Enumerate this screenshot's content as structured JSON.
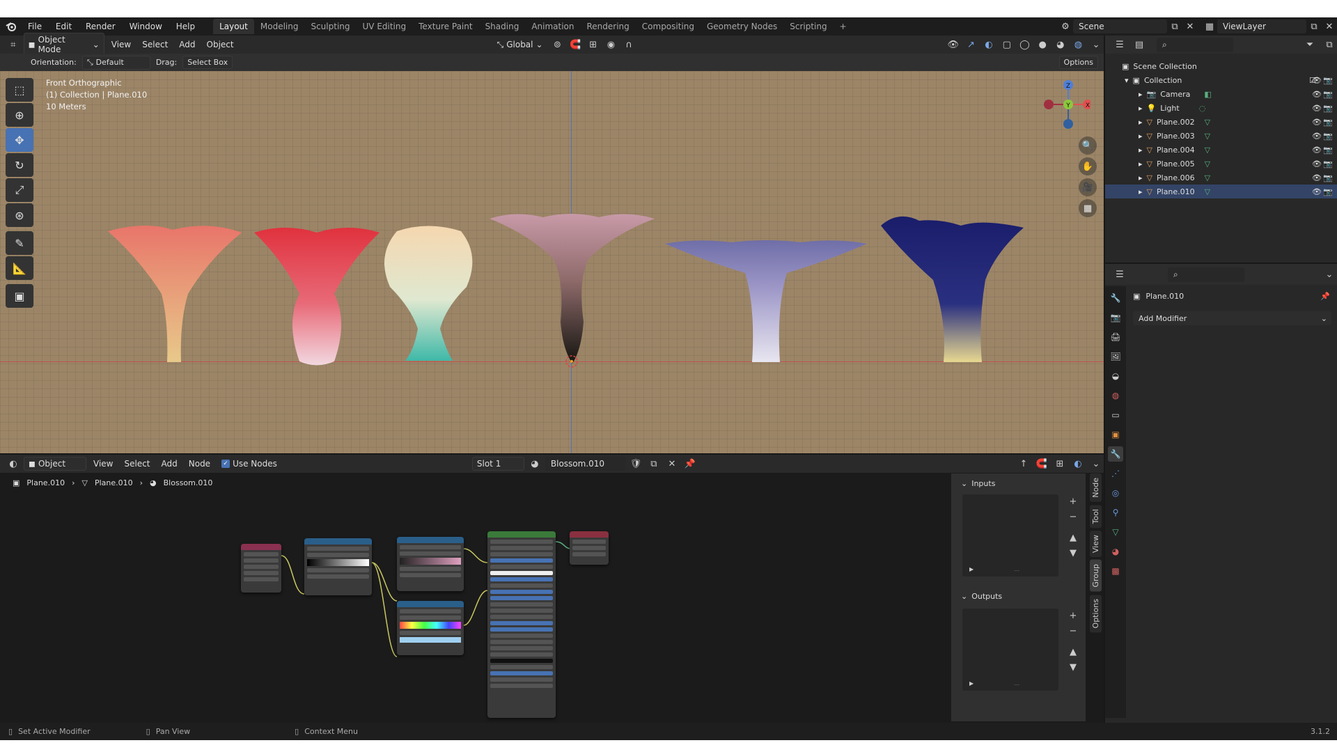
{
  "menu": [
    "File",
    "Edit",
    "Render",
    "Window",
    "Help"
  ],
  "workspaces": [
    "Layout",
    "Modeling",
    "Sculpting",
    "UV Editing",
    "Texture Paint",
    "Shading",
    "Animation",
    "Rendering",
    "Compositing",
    "Geometry Nodes",
    "Scripting"
  ],
  "plus": "+",
  "scene": "Scene",
  "view_layer": "ViewLayer",
  "view3d_header": {
    "mode": "Object Mode",
    "view": "View",
    "select": "Select",
    "add": "Add",
    "object": "Object",
    "transform": "Global"
  },
  "tool_header": {
    "orientation_label": "Orientation:",
    "orientation": "Default",
    "drag_label": "Drag:",
    "drag": "Select Box",
    "options": "Options"
  },
  "viewport": {
    "view_name": "Front Orthographic",
    "collection": "(1) Collection | Plane.010",
    "scale": "10 Meters"
  },
  "gizmo": {
    "z": "Z",
    "y": "Y",
    "x": "X"
  },
  "outliner": {
    "root": "Scene Collection",
    "collection": "Collection",
    "items": [
      "Camera",
      "Light",
      "Plane.002",
      "Plane.003",
      "Plane.004",
      "Plane.005",
      "Plane.006",
      "Plane.010"
    ]
  },
  "properties": {
    "object": "Plane.010",
    "add_modifier": "Add Modifier"
  },
  "node_header": {
    "type": "Object",
    "view": "View",
    "select": "Select",
    "add": "Add",
    "node": "Node",
    "use_nodes": "Use Nodes",
    "slot": "Slot 1",
    "material": "Blossom.010"
  },
  "breadcrumb": [
    "Plane.010",
    "Plane.010",
    "Blossom.010"
  ],
  "npanel": {
    "inputs": "Inputs",
    "outputs": "Outputs",
    "tabs": [
      "Node",
      "Tool",
      "View",
      "Group",
      "Options"
    ]
  },
  "status": {
    "left": "Set Active Modifier",
    "mid": "Pan View",
    "right": "Context Menu",
    "version": "3.1.2"
  },
  "colors": {
    "viewport_bg": "#9c8567",
    "accent": "#4772b3"
  }
}
